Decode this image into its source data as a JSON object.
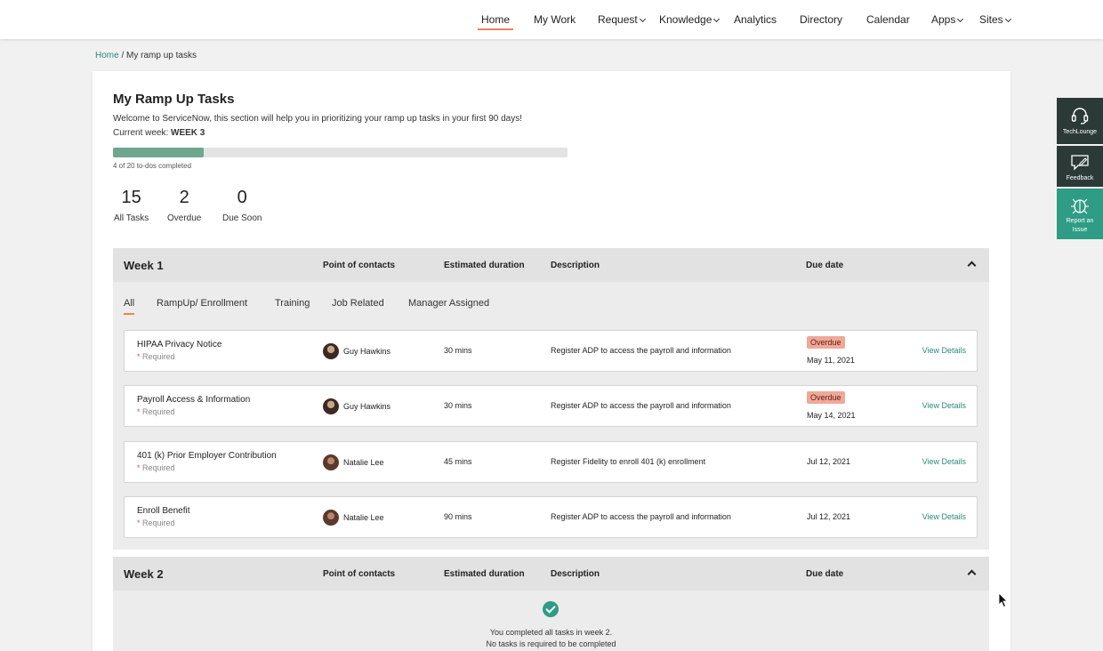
{
  "nav": {
    "items": [
      {
        "label": "Home",
        "active": true
      },
      {
        "label": "My Work",
        "active": false
      },
      {
        "label": "Request",
        "dropdown": true
      },
      {
        "label": "Knowledge",
        "dropdown": true
      },
      {
        "label": "Analytics",
        "active": false
      },
      {
        "label": "Directory",
        "active": false
      },
      {
        "label": "Calendar",
        "active": false
      },
      {
        "label": "Apps",
        "dropdown": true
      },
      {
        "label": "Sites",
        "dropdown": true
      }
    ]
  },
  "breadcrumb": {
    "home": "Home",
    "separator": "/",
    "current": "My ramp up tasks"
  },
  "page": {
    "title": "My Ramp Up Tasks",
    "welcome": "Welcome to ServiceNow, this section will help you in prioritizing your ramp up tasks in your first 90 days!",
    "current_week_label": "Current week:",
    "current_week": "WEEK 3",
    "progress_fraction": 0.2,
    "progress_text": "4 of 20 to-dos completed"
  },
  "stats": [
    {
      "value": "15",
      "label": "All Tasks"
    },
    {
      "value": "2",
      "label": "Overdue"
    },
    {
      "value": "0",
      "label": "Due Soon"
    }
  ],
  "columns": {
    "contact": "Point of contacts",
    "duration": "Estimated duration",
    "description": "Description",
    "due": "Due date"
  },
  "week1": {
    "title": "Week 1",
    "tabs": [
      "All",
      "RampUp/ Enrollment",
      "Training",
      "Job Related",
      "Manager Assigned"
    ],
    "tasks": [
      {
        "name": "HIPAA Privacy Notice",
        "required": "Required",
        "contact": "Guy Hawkins",
        "duration": "30 mins",
        "description": "Register ADP to access the payroll and information",
        "badge": "Overdue",
        "due": "May 11, 2021",
        "action": "View Details"
      },
      {
        "name": "Payroll Access & Information",
        "required": "Required",
        "contact": "Guy Hawkins",
        "duration": "30 mins",
        "description": "Register ADP to access the payroll and information",
        "badge": "Overdue",
        "due": "May 14, 2021",
        "action": "View Details"
      },
      {
        "name": "401 (k) Prior Employer  Contribution",
        "required": "Required",
        "contact": "Natalie Lee",
        "duration": "45 mins",
        "description": "Register Fidelity to enroll 401 (k) enrollment",
        "badge": "",
        "due": "Jul 12, 2021",
        "action": "View Details"
      },
      {
        "name": "Enroll Benefit",
        "required": "Required",
        "contact": "Natalie Lee",
        "duration": "90 mins",
        "description": "Register ADP to access the payroll and information",
        "badge": "",
        "due": "Jul 12, 2021",
        "action": "View Details"
      }
    ]
  },
  "week2": {
    "title": "Week 2",
    "done_line1": "You completed all tasks in week 2.",
    "done_line2": "No tasks is required to be completed"
  },
  "side_panel": {
    "techlounge": "TechLounge",
    "feedback": "Feedback",
    "report": "Report an Issue",
    "colors": {
      "dark": "#2b3a37",
      "accent": "#2f9c85"
    }
  },
  "colors": {
    "accent": "#e8835a",
    "link": "#2a8a7a",
    "progress": "#6ea690",
    "overdue": "#f0a898"
  }
}
